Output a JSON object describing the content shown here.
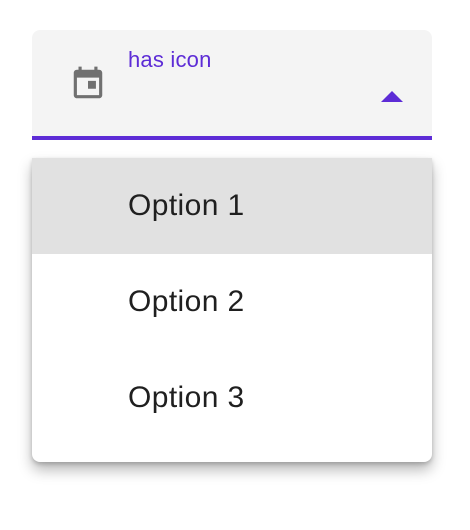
{
  "select": {
    "label": "has icon",
    "leading_icon": "calendar-icon",
    "trailing_icon": "arrow-up-icon",
    "accent_color": "#5d2cd6",
    "expanded": true
  },
  "menu": {
    "items": [
      {
        "label": "Option 1",
        "selected": true
      },
      {
        "label": "Option 2",
        "selected": false
      },
      {
        "label": "Option 3",
        "selected": false
      }
    ]
  }
}
